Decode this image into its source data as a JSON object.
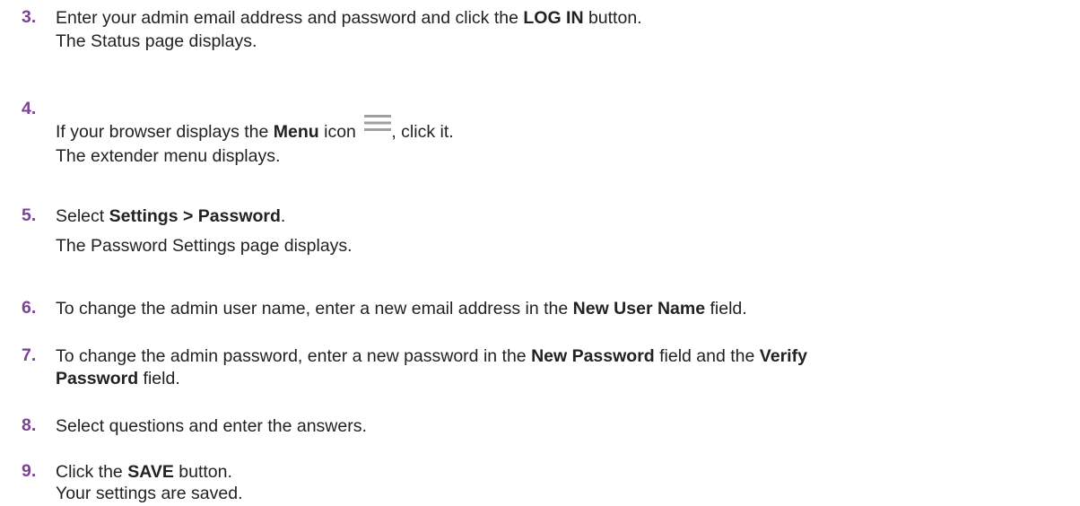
{
  "steps": [
    {
      "number": "3.",
      "lines": [
        [
          "Enter your admin email address and password and click the ",
          "LOG IN",
          " button."
        ],
        [
          "The Status page displays."
        ]
      ]
    },
    {
      "number": "4.",
      "line1": {
        "a": "If your browser displays the ",
        "b": "Menu",
        "c": " icon ",
        "d": ", click it."
      },
      "line2": "The extender menu displays."
    },
    {
      "number": "5.",
      "line1": {
        "a": "Select ",
        "b": "Settings > Password",
        "c": "."
      },
      "line2": "The Password Settings page displays."
    },
    {
      "number": "6.",
      "line1": {
        "a": "To change the admin user name, enter a new email address in the ",
        "b": "New User Name",
        "c": " field."
      }
    },
    {
      "number": "7.",
      "line1": {
        "a": "To change the admin password, enter a new password in the ",
        "b": "New Password",
        "c": " field and the ",
        "d": "Verify"
      },
      "line2": {
        "a": "Password",
        "b": " field."
      }
    },
    {
      "number": "8.",
      "line1": "Select questions and enter the answers."
    },
    {
      "number": "9.",
      "line1": {
        "a": "Click the ",
        "b": "SAVE",
        "c": " button."
      },
      "line2": "Your settings are saved."
    }
  ],
  "step3": {
    "number": "3.",
    "a": "Enter your admin email address and password and click the ",
    "b": "LOG IN",
    "c": " button.",
    "line2": "The Status page displays."
  },
  "icons": {
    "menu": "hamburger-menu-icon",
    "menu_color": "#a0a0a0"
  },
  "colors": {
    "step_number": "#7b4397",
    "text": "#222222"
  }
}
